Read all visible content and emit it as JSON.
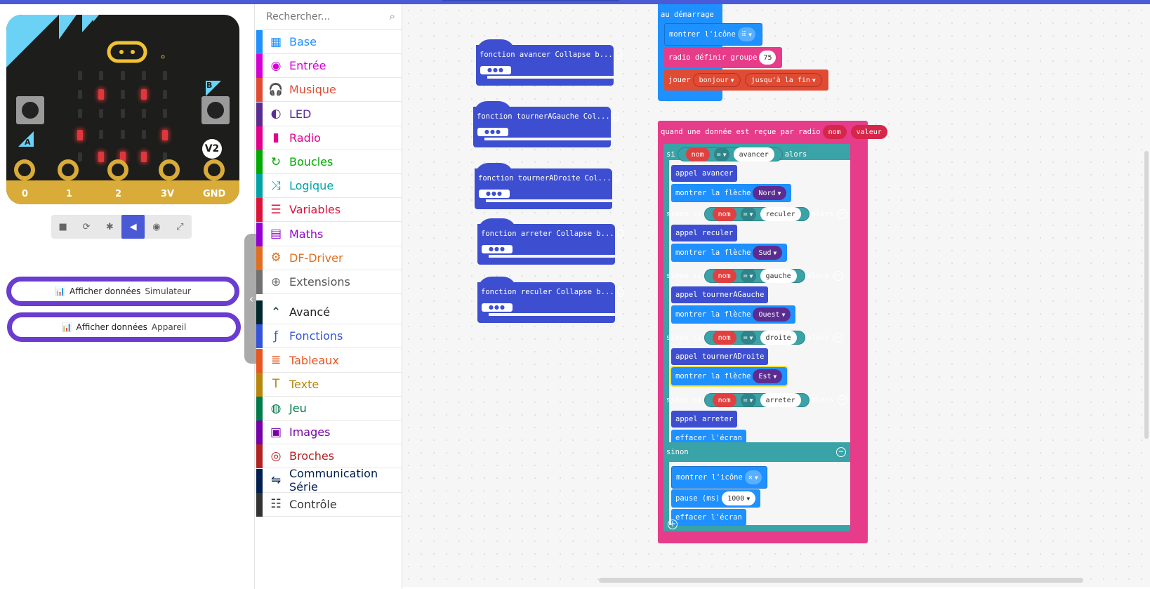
{
  "colors": {
    "accent": "#4b5ad6",
    "board": "#1d1d1b",
    "gold": "#d9ab38",
    "functions": "#3d4fd0",
    "radio": "#e63c8a",
    "logic": "#3aa3a8",
    "basic": "#1e90ff",
    "music": "#e04b33",
    "variables": "#e04040"
  },
  "simulator": {
    "badge": "V2",
    "pins": [
      "0",
      "1",
      "2",
      "3V",
      "GND"
    ],
    "button_a": "A",
    "button_b": "B",
    "controls": [
      "stop-icon",
      "restart-icon",
      "debug-icon",
      "sound-icon",
      "screenshot-icon",
      "fullscreen-icon"
    ],
    "data_buttons": [
      {
        "label": "Afficher données",
        "sub": "Simulateur"
      },
      {
        "label": "Afficher données",
        "sub": "Appareil"
      }
    ]
  },
  "toolbox": {
    "search_placeholder": "Rechercher...",
    "categories": [
      {
        "label": "Base",
        "color": "#1e90ff",
        "icon": "grid-icon"
      },
      {
        "label": "Entrée",
        "color": "#d400d4",
        "icon": "target-icon"
      },
      {
        "label": "Musique",
        "color": "#e04b33",
        "icon": "headphones-icon"
      },
      {
        "label": "LED",
        "color": "#5c2d91",
        "icon": "toggle-icon"
      },
      {
        "label": "Radio",
        "color": "#e3008c",
        "icon": "signal-icon"
      },
      {
        "label": "Boucles",
        "color": "#00aa00",
        "icon": "loop-icon"
      },
      {
        "label": "Logique",
        "color": "#00a4a6",
        "icon": "shuffle-icon"
      },
      {
        "label": "Variables",
        "color": "#dc143c",
        "icon": "list-icon"
      },
      {
        "label": "Maths",
        "color": "#9400d3",
        "icon": "calculator-icon"
      },
      {
        "label": "DF-Driver",
        "color": "#e07020",
        "icon": "gear-icon"
      },
      {
        "label": "Extensions",
        "color": "#717171",
        "icon": "plus-icon"
      },
      {
        "label": "Avancé",
        "color": "#00272b",
        "icon": "chevron-up-icon"
      },
      {
        "label": "Fonctions",
        "color": "#3455db",
        "icon": "function-icon"
      },
      {
        "label": "Tableaux",
        "color": "#e65722",
        "icon": "array-icon"
      },
      {
        "label": "Texte",
        "color": "#b8860b",
        "icon": "text-icon"
      },
      {
        "label": "Jeu",
        "color": "#007a4b",
        "icon": "gamepad-icon"
      },
      {
        "label": "Images",
        "color": "#7600a8",
        "icon": "image-icon"
      },
      {
        "label": "Broches",
        "color": "#b22222",
        "icon": "pins-icon"
      },
      {
        "label": "Communication Série",
        "color": "#002050",
        "icon": "usb-icon"
      },
      {
        "label": "Contrôle",
        "color": "#333333",
        "icon": "control-icon"
      }
    ]
  },
  "workspace": {
    "functions": [
      "fonction avancer Collapse b...",
      "fonction tournerAGauche Col...",
      "fonction tournerADroite Col...",
      "fonction arreter Collapse b...",
      "fonction reculer Collapse b..."
    ],
    "dots": "●●●",
    "on_start": {
      "title": "au démarrage",
      "show_icon": "montrer l'icône",
      "radio_group": "radio définir groupe",
      "group_value": "75",
      "play": "jouer",
      "melody": "bonjour",
      "until": "jusqu'à la fin"
    },
    "on_radio": {
      "title": "quand une donnée est reçue par radio",
      "param1": "nom",
      "param2": "valeur",
      "if_kw": "si",
      "elif_kw": "sinon si",
      "else_kw": "sinon",
      "then_kw": "alors",
      "eq": "=",
      "var": "nom",
      "call_kw": "appel",
      "arrow_kw": "montrer la flèche",
      "clear": "effacer l'écran",
      "show_icon": "montrer l'icône",
      "pause": "pause (ms)",
      "pause_value": "1000",
      "branches": [
        {
          "cond": "avancer",
          "call": "avancer",
          "arrow": "Nord"
        },
        {
          "cond": "reculer",
          "call": "reculer",
          "arrow": "Sud"
        },
        {
          "cond": "gauche",
          "call": "tournerAGauche",
          "arrow": "Ouest"
        },
        {
          "cond": "droite",
          "call": "tournerADroite",
          "arrow": "Est"
        },
        {
          "cond": "arreter",
          "call": "arreter"
        }
      ]
    }
  }
}
